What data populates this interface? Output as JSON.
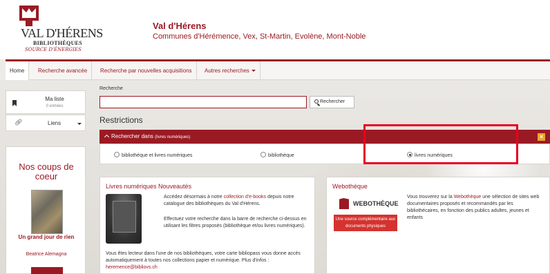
{
  "header": {
    "brand": "VAL D'HÉRENS",
    "brand_sub": "BIBLIOTHÈQUES",
    "brand_tag": "SOURCE D'ÉNERGIES",
    "title": "Val d'Hérens",
    "subtitle": "Communes d'Hérémence, Vex, St-Martin, Evolène, Mont-Noble"
  },
  "nav": {
    "home": "Home",
    "advanced": "Recherche avancée",
    "new": "Recherche par nouvelles acquisitions",
    "other": "Autres recherches"
  },
  "sidebar": {
    "list_title": "Ma liste",
    "list_count": "0 entrées",
    "links": "Liens",
    "panel_title": "Nos coups de coeur",
    "book_title": "Un grand jour de rien",
    "book_author": "Beatrice Alemagna"
  },
  "search": {
    "label": "Recherche",
    "value": "",
    "button": "Rechercher"
  },
  "restrictions": {
    "heading": "Restrictions",
    "bar_label": "Rechercher dans",
    "bar_scope": "(livres numériques)",
    "close": "×",
    "options": [
      {
        "label": "bibliothèque et livres numériques",
        "checked": false
      },
      {
        "label": "bibliothèque",
        "checked": false
      },
      {
        "label": "livres numériques",
        "checked": true
      }
    ]
  },
  "ebooks": {
    "title": "Livres numériques Nouveautés",
    "p1_a": "Accédez désormais à notre ",
    "p1_link": "collection d'e-books",
    "p1_b": " depuis notre catalogue des bibliothèques du Val d'Hérens.",
    "p2": "Effectuez votre recherche dans la barre de recherche ci-dessus en utilisant les filtres proposés (bibliothèque et/ou livres numériques).",
    "p3_a": "Vous êtes lecteur dans l'une de nos bibliothèques, votre carte bibliopass vous donne accès automatiquement à toutes nos collections papier et numérique. Plus d'infos : ",
    "p3_link": "heremence@bibliovs.ch"
  },
  "webotheque": {
    "title": "Webothèque",
    "logo_word": "WEBOTHÈQUE",
    "logo_banner": "Une source complémentaire aux documents physiques",
    "p_a": "Vous trouverez sur la ",
    "p_link": "Webothèque",
    "p_b": " une sélection de sites web documentaires proposés et recommandés par les bibliothécaires, en fonction des publics adultes, jeunes et enfants"
  },
  "colors": {
    "brand": "#9a1a24",
    "highlight": "#e8001c",
    "close_button": "#e8a82a"
  }
}
